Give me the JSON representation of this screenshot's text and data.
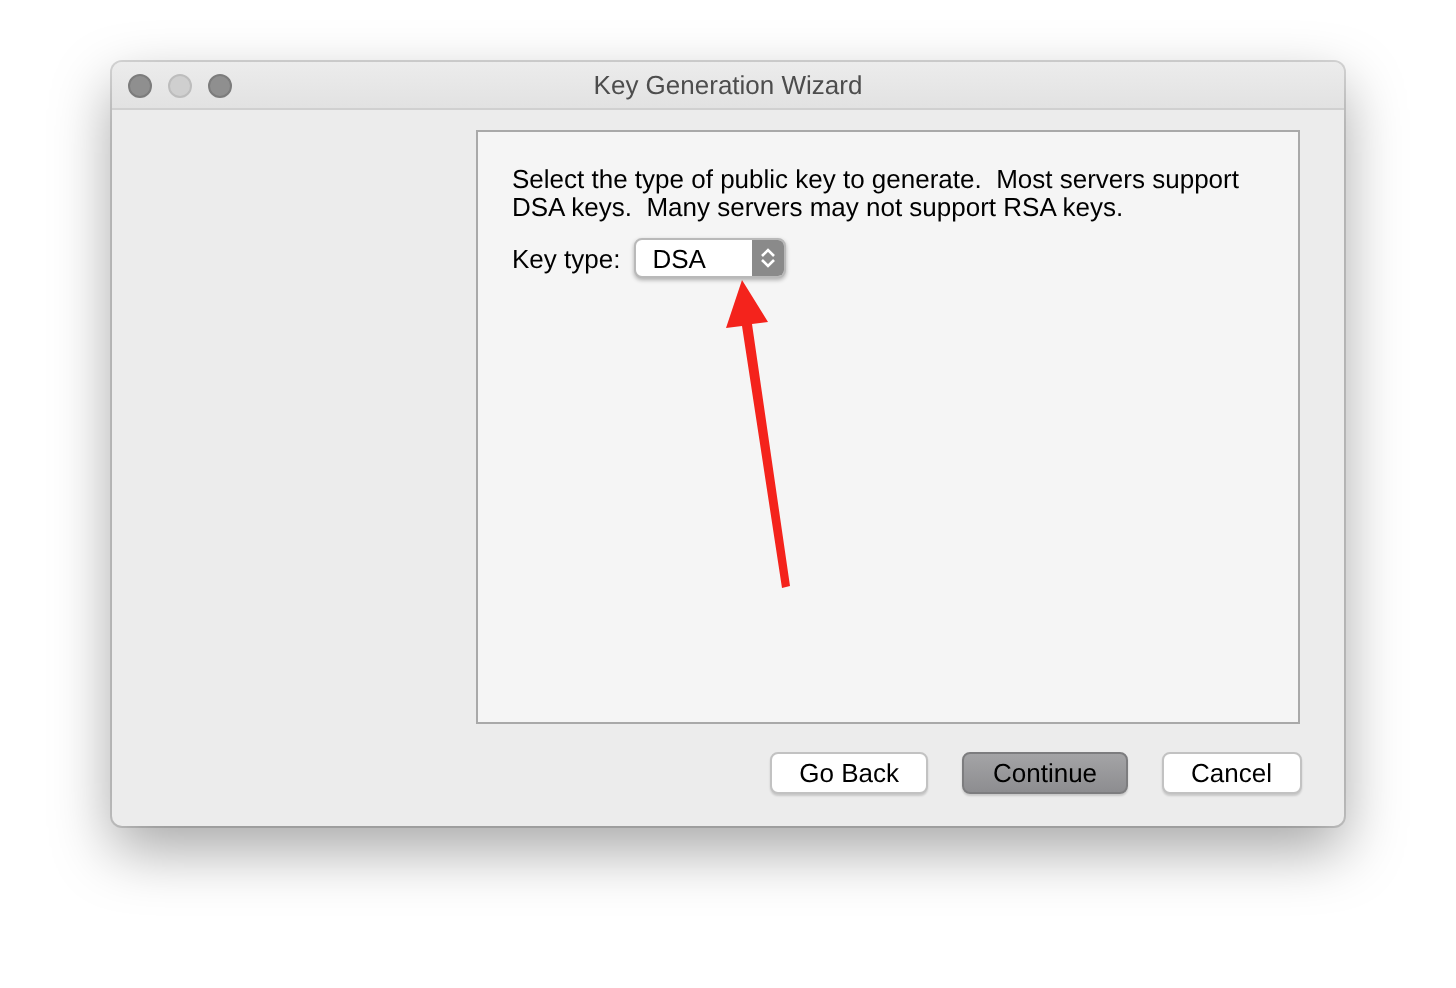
{
  "window": {
    "title": "Key Generation Wizard"
  },
  "description": "Select the type of public key to generate.  Most servers support DSA keys.  Many servers may not support RSA keys.",
  "key_type": {
    "label": "Key type:",
    "value": "DSA"
  },
  "buttons": [
    {
      "label": "Go Back",
      "default": false
    },
    {
      "label": "Continue",
      "default": true
    },
    {
      "label": "Cancel",
      "default": false
    }
  ]
}
